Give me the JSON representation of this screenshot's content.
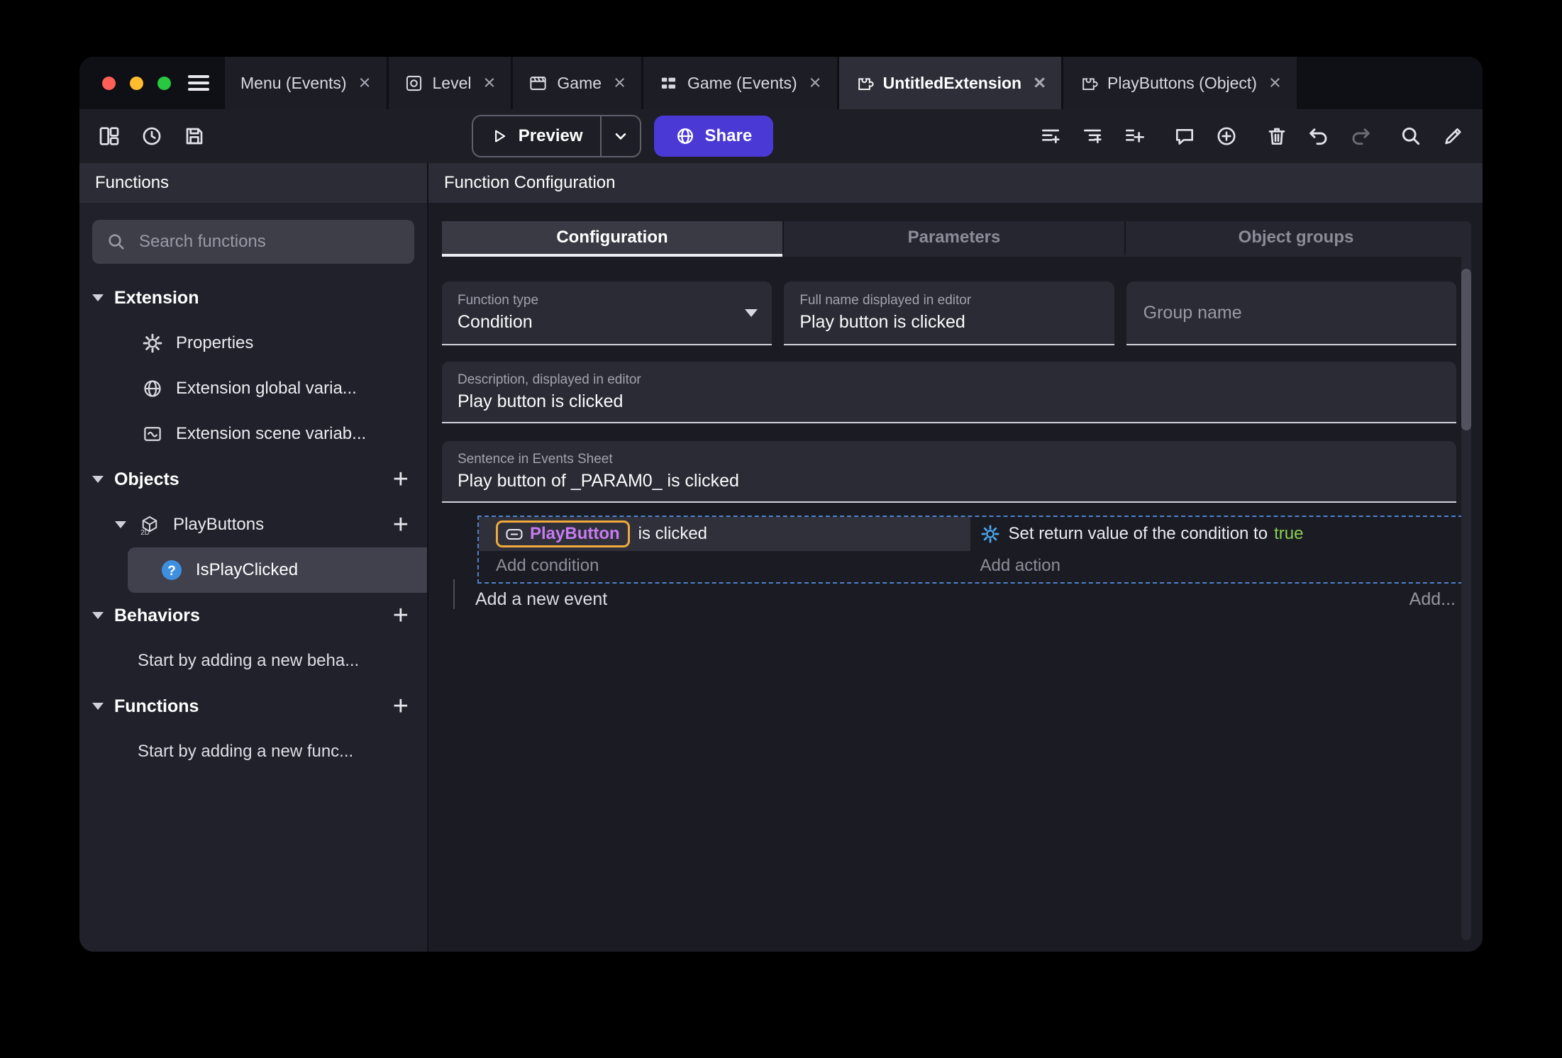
{
  "glyphs": {
    "close": "×",
    "plus": "+"
  },
  "window_tabs": [
    {
      "label": "Menu (Events)"
    },
    {
      "label": "Level"
    },
    {
      "label": "Game"
    },
    {
      "label": "Game (Events)"
    },
    {
      "label": "UntitledExtension"
    },
    {
      "label": "PlayButtons (Object)"
    }
  ],
  "toolbar": {
    "preview": "Preview",
    "share": "Share"
  },
  "sidebar": {
    "header": "Functions",
    "search_placeholder": "Search functions",
    "sections": {
      "extension": "Extension",
      "objects": "Objects",
      "behaviors": "Behaviors",
      "functions": "Functions"
    },
    "items": {
      "properties": "Properties",
      "global_vars": "Extension global varia...",
      "scene_vars": "Extension scene variab...",
      "play_buttons": "PlayButtons",
      "is_play_clicked": "IsPlayClicked"
    },
    "hints": {
      "behaviors": "Start by adding a new beha...",
      "functions": "Start by adding a new func..."
    }
  },
  "main": {
    "header": "Function Configuration",
    "tabs": [
      {
        "label": "Configuration"
      },
      {
        "label": "Parameters"
      },
      {
        "label": "Object groups"
      }
    ],
    "fields": {
      "function_type": {
        "label": "Function type",
        "value": "Condition"
      },
      "full_name": {
        "label": "Full name displayed in editor",
        "value": "Play button is clicked"
      },
      "group_name": {
        "placeholder": "Group name"
      },
      "description": {
        "label": "Description, displayed in editor",
        "value": "Play button is clicked"
      },
      "sentence": {
        "label": "Sentence in Events Sheet",
        "value": "Play button of _PARAM0_ is clicked"
      }
    },
    "events": {
      "condition_object": "PlayButton",
      "condition_text": "is clicked",
      "add_condition": "Add condition",
      "action_text": "Set return value of the condition to",
      "action_value": "true",
      "add_action": "Add action",
      "add_event": "Add a new event",
      "add_more": "Add..."
    }
  },
  "icons": {
    "cube_2d_label": "2D",
    "function_glyph": "?"
  },
  "colors": {
    "share_accent": "#4a39d4",
    "object_chip_border": "#f0a93c",
    "object_chip_text": "#c67bf0",
    "boolean_true": "#8bcf52",
    "selection_dashed_border": "#4e82c8"
  }
}
